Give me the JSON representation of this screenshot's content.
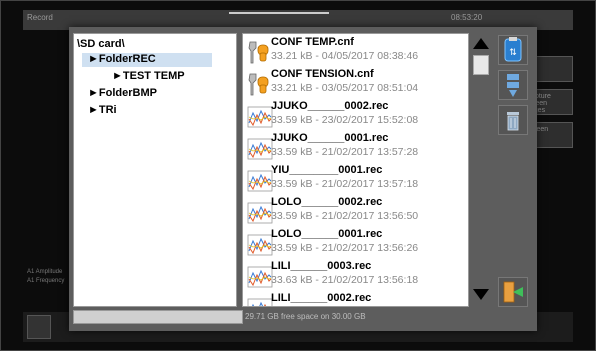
{
  "background": {
    "top_left_text": "Record",
    "top_right_text": "08:53:20",
    "side_buttons": [
      "File",
      "Capture screen pages",
      "Screen"
    ],
    "left_lines": [
      "A1 Amplitude",
      "A1 Frequency"
    ]
  },
  "tree": {
    "root": "\\SD card\\",
    "items": [
      {
        "label": "►FolderREC",
        "selected": true
      },
      {
        "label": "►TEST TEMP",
        "selected": false
      },
      {
        "label": "►FolderBMP",
        "selected": false
      },
      {
        "label": "►TRi",
        "selected": false
      }
    ]
  },
  "files": [
    {
      "name": "CONF TEMP.cnf",
      "meta": "33.21 kB - 04/05/2017 08:38:46",
      "icon": "config-file-icon"
    },
    {
      "name": "CONF TENSION.cnf",
      "meta": "33.21 kB - 03/05/2017 08:51:04",
      "icon": "config-file-icon"
    },
    {
      "name": "JJUKO______0002.rec",
      "meta": "33.59 kB - 23/02/2017 15:52:08",
      "icon": "record-file-icon"
    },
    {
      "name": "JJUKO______0001.rec",
      "meta": "33.59 kB - 21/02/2017 13:57:28",
      "icon": "record-file-icon"
    },
    {
      "name": "YIU________0001.rec",
      "meta": "33.59 kB - 21/02/2017 13:57:18",
      "icon": "record-file-icon"
    },
    {
      "name": "LOLO______0002.rec",
      "meta": "33.59 kB - 21/02/2017 13:56:50",
      "icon": "record-file-icon"
    },
    {
      "name": "LOLO______0001.rec",
      "meta": "33.59 kB - 21/02/2017 13:56:26",
      "icon": "record-file-icon"
    },
    {
      "name": "LILI______0003.rec",
      "meta": "33.63 kB - 21/02/2017 13:56:18",
      "icon": "record-file-icon"
    },
    {
      "name": "LILI______0002.rec",
      "meta": "",
      "icon": "record-file-icon"
    }
  ],
  "status": {
    "free_space": "29.71 GB free space on 30.00 GB"
  },
  "actions": [
    {
      "name": "usb-drive-button",
      "icon": "usb-drive-icon"
    },
    {
      "name": "move-to-device-button",
      "icon": "transfer-icon"
    },
    {
      "name": "delete-button",
      "icon": "trash-icon"
    },
    {
      "name": "exit-button",
      "icon": "exit-door-icon"
    }
  ],
  "colors": {
    "dialog_bg": "#5d5d5d",
    "selection": "#cfe0f1",
    "meta_text": "#888888"
  }
}
